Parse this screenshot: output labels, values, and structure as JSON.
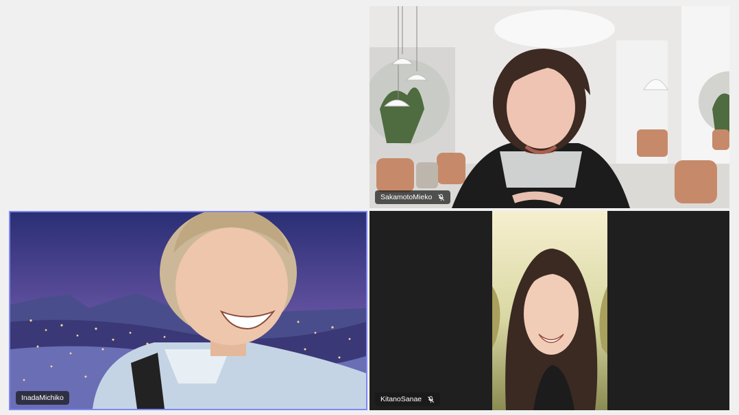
{
  "meeting": {
    "participants": [
      {
        "name": "SakamotoMieko",
        "muted": true,
        "speaking": false
      },
      {
        "name": "InadaMichiko",
        "muted": false,
        "speaking": true
      },
      {
        "name": "KitanoSanae",
        "muted": true,
        "speaking": false
      }
    ]
  },
  "icons": {
    "muted_mic": "mic-off-icon"
  },
  "colors": {
    "page_background": "#f0f0f0",
    "tile_background": "#1f1f1f",
    "active_speaker_border": "#7f85f5",
    "nametag_background": "#191919",
    "nametag_text": "#ffffff"
  }
}
